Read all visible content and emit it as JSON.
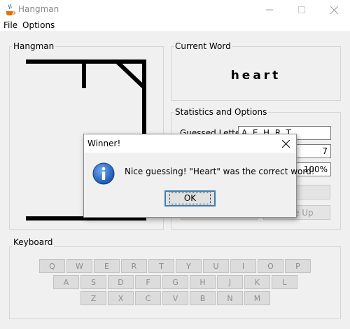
{
  "window": {
    "title": "Hangman"
  },
  "menu": {
    "items": [
      "File",
      "Options"
    ]
  },
  "hangman_panel": {
    "title": "Hangman"
  },
  "word_panel": {
    "title": "Current Word",
    "word": "heart"
  },
  "stats_panel": {
    "title": "Statistics and Options",
    "guessed_label": "Guessed Letters",
    "guessed_value": "A, E, H, R, T",
    "count_value": "7",
    "percent_value": "100%",
    "give_up_label": "Give Up"
  },
  "keyboard": {
    "title": "Keyboard",
    "rows": [
      [
        "Q",
        "W",
        "E",
        "R",
        "T",
        "Y",
        "U",
        "I",
        "O",
        "P"
      ],
      [
        "A",
        "S",
        "D",
        "F",
        "G",
        "H",
        "J",
        "K",
        "L"
      ],
      [
        "Z",
        "X",
        "C",
        "V",
        "B",
        "N",
        "M"
      ]
    ]
  },
  "dialog": {
    "title": "Winner!",
    "message": "Nice guessing! \"Heart\" was the correct word!",
    "ok_label": "OK",
    "icon": "info-icon",
    "accent": "#1e6fc6"
  }
}
